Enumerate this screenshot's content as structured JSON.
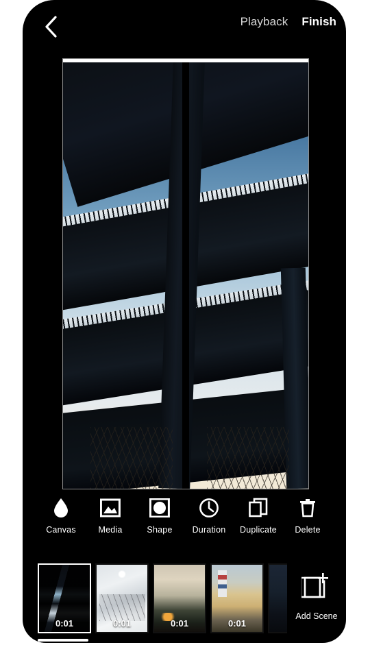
{
  "app": {
    "screen_name": "Scene Editor",
    "background_color": "#000000",
    "accent_color": "#ffffff"
  },
  "topbar": {
    "back_icon": "chevron-left-icon",
    "playback_label": "Playback",
    "finish_label": "Finish"
  },
  "canvas": {
    "name": "preview-canvas",
    "split_panes": 2,
    "border_color": "#8e8e8e",
    "top_strip_color": "#ffffff",
    "description": "Split-screen photo of a highway overpass interchange against blue sky"
  },
  "toolbar": {
    "items": [
      {
        "label": "Canvas",
        "icon": "droplet-icon",
        "name": "tool-canvas"
      },
      {
        "label": "Media",
        "icon": "image-icon",
        "name": "tool-media"
      },
      {
        "label": "Shape",
        "icon": "shape-icon",
        "name": "tool-shape"
      },
      {
        "label": "Duration",
        "icon": "clock-icon",
        "name": "tool-duration"
      },
      {
        "label": "Duplicate",
        "icon": "copy-icon",
        "name": "tool-duplicate"
      },
      {
        "label": "Delete",
        "icon": "trash-icon",
        "name": "tool-delete"
      }
    ]
  },
  "filmstrip": {
    "scenes": [
      {
        "duration": "0:01",
        "art": "art-bridge",
        "selected": true,
        "name": "scene-thumbnail-1"
      },
      {
        "duration": "0:01",
        "art": "art-snow",
        "selected": false,
        "name": "scene-thumbnail-2"
      },
      {
        "duration": "0:01",
        "art": "art-mist",
        "selected": false,
        "name": "scene-thumbnail-3"
      },
      {
        "duration": "0:01",
        "art": "art-light",
        "selected": false,
        "name": "scene-thumbnail-4"
      },
      {
        "duration": "",
        "art": "art-dark",
        "selected": false,
        "name": "scene-thumbnail-5"
      }
    ],
    "add_scene_label": "Add Scene",
    "add_scene_icon": "square-plus-icon"
  }
}
